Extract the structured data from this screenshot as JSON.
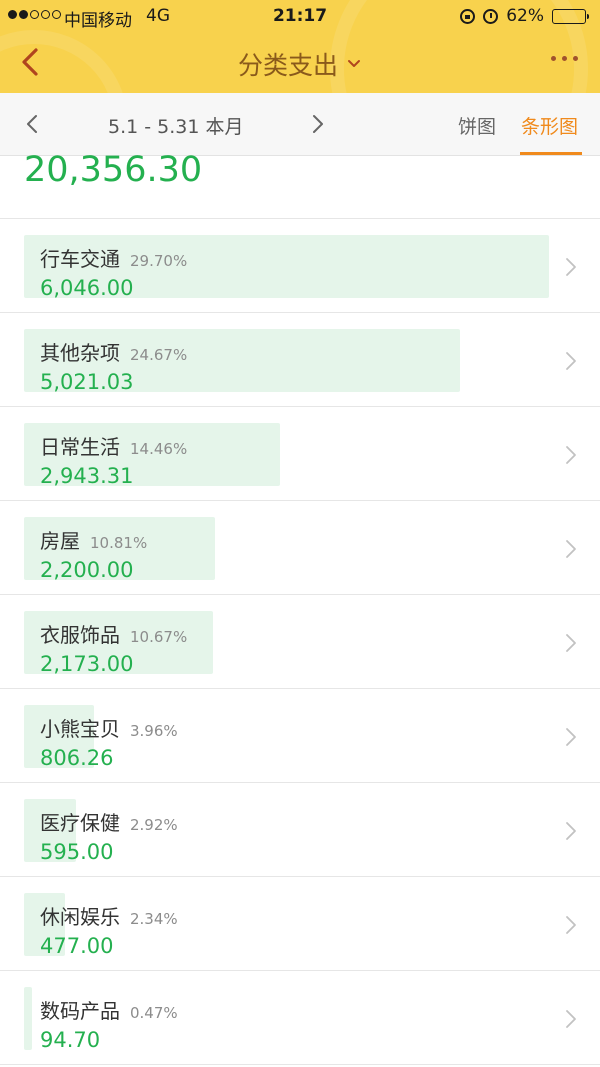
{
  "status_bar": {
    "carrier": "中国移动",
    "network": "4G",
    "time": "21:17",
    "battery": "62%",
    "battery_level": 0.62
  },
  "nav": {
    "title": "分类支出"
  },
  "period": {
    "range": "5.1 - 5.31 本月"
  },
  "tabs": [
    {
      "label": "饼图",
      "active": false
    },
    {
      "label": "条形图",
      "active": true
    }
  ],
  "total": "20,356.30",
  "colors": {
    "header": "#f8d24d",
    "accent_orange": "#f08a1c",
    "amount_green": "#24b04f",
    "bar_fill": "#e5f5ea"
  },
  "categories": [
    {
      "name": "行车交通",
      "percent": "29.70%",
      "amount": "6,046.00",
      "share": 0.297
    },
    {
      "name": "其他杂项",
      "percent": "24.67%",
      "amount": "5,021.03",
      "share": 0.2467
    },
    {
      "name": "日常生活",
      "percent": "14.46%",
      "amount": "2,943.31",
      "share": 0.1446
    },
    {
      "name": "房屋",
      "percent": "10.81%",
      "amount": "2,200.00",
      "share": 0.1081
    },
    {
      "name": "衣服饰品",
      "percent": "10.67%",
      "amount": "2,173.00",
      "share": 0.1067
    },
    {
      "name": "小熊宝贝",
      "percent": "3.96%",
      "amount": "806.26",
      "share": 0.0396
    },
    {
      "name": "医疗保健",
      "percent": "2.92%",
      "amount": "595.00",
      "share": 0.0292
    },
    {
      "name": "休闲娱乐",
      "percent": "2.34%",
      "amount": "477.00",
      "share": 0.0234
    },
    {
      "name": "数码产品",
      "percent": "0.47%",
      "amount": "94.70",
      "share": 0.0047
    }
  ]
}
